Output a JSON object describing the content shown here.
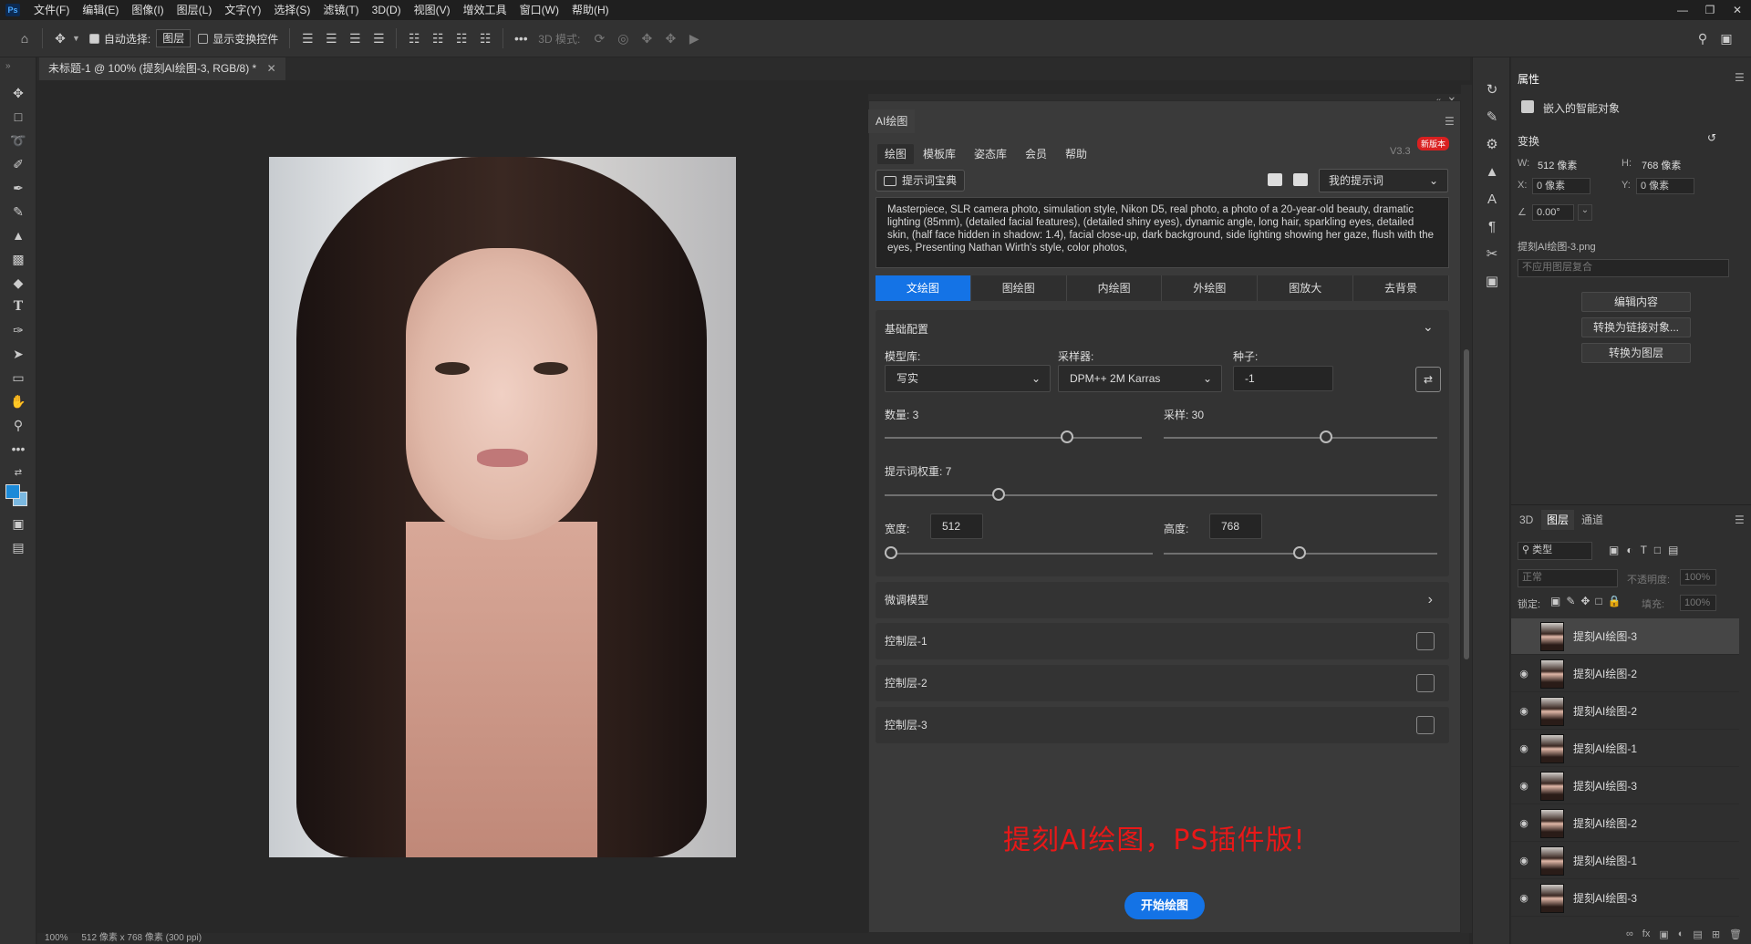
{
  "menubar": {
    "logo": "Ps",
    "items": [
      "文件(F)",
      "编辑(E)",
      "图像(I)",
      "图层(L)",
      "文字(Y)",
      "选择(S)",
      "滤镜(T)",
      "3D(D)",
      "视图(V)",
      "增效工具",
      "窗口(W)",
      "帮助(H)"
    ]
  },
  "optbar": {
    "auto_select": "自动选择:",
    "layer_sel": "图层",
    "show_transform": "显示变换控件",
    "mode3d": "3D 模式:"
  },
  "document": {
    "tab_title": "未标题-1 @ 100% (提刻AI绘图-3, RGB/8) *",
    "status_zoom": "100%",
    "status_info": "512 像素 x 768 像素 (300 ppi)"
  },
  "aipanel": {
    "tab": "AI绘图",
    "nav": [
      "绘图",
      "模板库",
      "姿态库",
      "会员",
      "帮助"
    ],
    "version": "V3.3",
    "badge": "新版本",
    "dict_btn": "提示词宝典",
    "my_prompts": "我的提示词",
    "prompt": "Masterpiece, SLR camera photo, simulation style, Nikon D5, real photo, a photo of a 20-year-old beauty, dramatic lighting (85mm), (detailed facial features), (detailed shiny eyes), dynamic angle, long hair, sparkling eyes, detailed skin, (half face hidden in shadow: 1.4), facial close-up, dark background, side lighting showing her gaze, flush with the eyes, Presenting Nathan Wirth's style, color photos,",
    "modes": [
      "文绘图",
      "图绘图",
      "内绘图",
      "外绘图",
      "图放大",
      "去背景"
    ],
    "base_title": "基础配置",
    "model_label": "模型库:",
    "model_value": "写实",
    "sampler_label": "采样器:",
    "sampler_value": "DPM++ 2M Karras",
    "seed_label": "种子:",
    "seed_value": "-1",
    "count_label": "数量: 3",
    "count_value": 3,
    "steps_label": "采样: 30",
    "steps_value": 30,
    "cfg_label": "提示词权重: 7",
    "cfg_value": 7,
    "width_label": "宽度:",
    "width_value": "512",
    "height_label": "高度:",
    "height_value": "768",
    "finetune": "微调模型",
    "controls": [
      "控制层-1",
      "控制层-2",
      "控制层-3"
    ],
    "slogan": "提刻AI绘图，PS插件版!",
    "start": "开始绘图"
  },
  "props": {
    "title": "属性",
    "smart_obj": "嵌入的智能对象",
    "transform": "变换",
    "w_label": "W:",
    "w_value": "512 像素",
    "h_label": "H:",
    "h_value": "768 像素",
    "x_label": "X:",
    "x_value": "0 像素",
    "y_label": "Y:",
    "y_value": "0 像素",
    "angle": "0.00°",
    "filename": "提刻AI绘图-3.png",
    "comp": "不应用图层复合",
    "btn_edit": "编辑内容",
    "btn_link": "转换为链接对象...",
    "btn_layer": "转换为图层"
  },
  "layers": {
    "tabs": [
      "3D",
      "图层",
      "通道"
    ],
    "kind": "类型",
    "blend": "正常",
    "opacity_label": "不透明度:",
    "opacity": "100%",
    "lock_label": "锁定:",
    "fill_label": "填充:",
    "fill": "100%",
    "items": [
      "提刻AI绘图-3",
      "提刻AI绘图-2",
      "提刻AI绘图-2",
      "提刻AI绘图-1",
      "提刻AI绘图-3",
      "提刻AI绘图-2",
      "提刻AI绘图-1",
      "提刻AI绘图-3"
    ]
  }
}
